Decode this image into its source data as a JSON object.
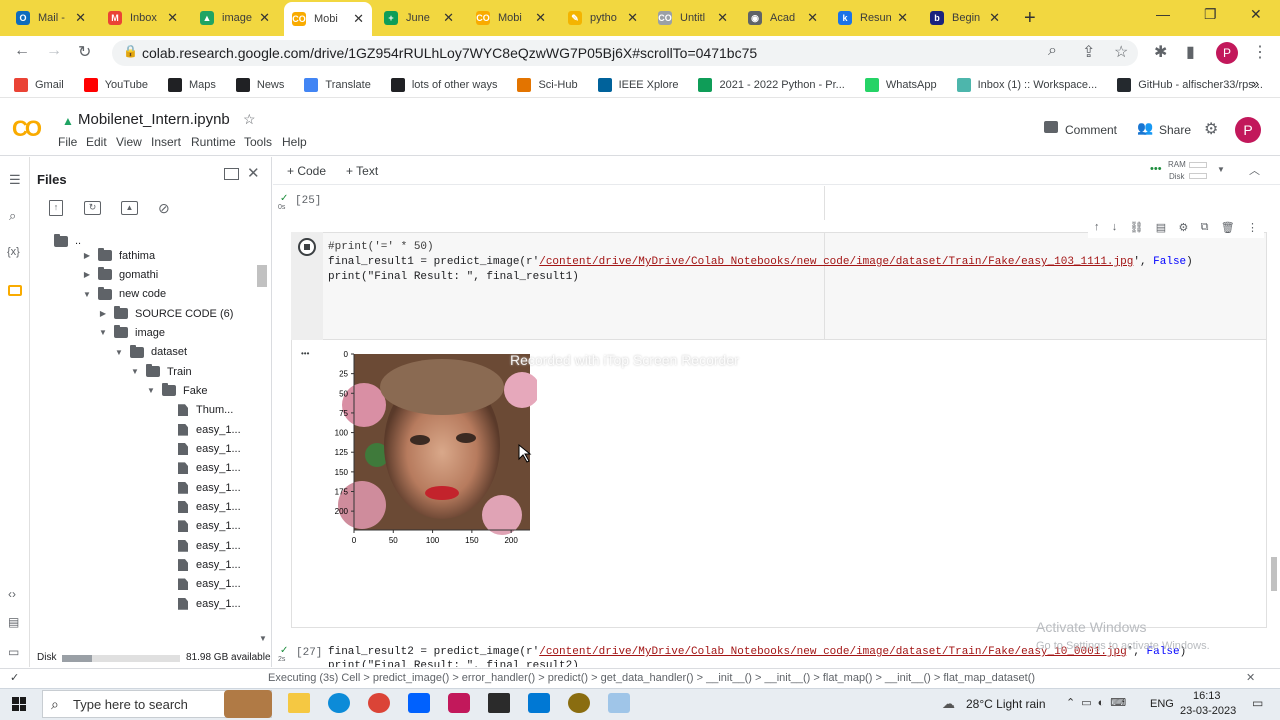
{
  "browser": {
    "tabs": [
      {
        "label": "Mail -",
        "color": "#0f6cbd",
        "glyph": "O"
      },
      {
        "label": "Inbox",
        "color": "#ea4335",
        "glyph": "M"
      },
      {
        "label": "image",
        "color": "#1fa463",
        "glyph": "▲"
      },
      {
        "label": "Mobi",
        "color": "#f9ab00",
        "glyph": "CO"
      },
      {
        "label": "June",
        "color": "#0f9d58",
        "glyph": "+"
      },
      {
        "label": "Mobi",
        "color": "#f9ab00",
        "glyph": "CO"
      },
      {
        "label": "pytho",
        "color": "#f4b400",
        "glyph": "✎"
      },
      {
        "label": "Untitl",
        "color": "#9aa0a6",
        "glyph": "CO"
      },
      {
        "label": "Acad",
        "color": "#5f6368",
        "glyph": "◉"
      },
      {
        "label": "Resun",
        "color": "#1a73e8",
        "glyph": "k"
      },
      {
        "label": "Begin",
        "color": "#1a237e",
        "glyph": "b"
      }
    ],
    "new_tab": "+",
    "url": "colab.research.google.com/drive/1GZ954rRULhLoy7WYC8eQzwWG7P05Bj6X#scrollTo=0471bc75",
    "profile_initial": "P",
    "bookmarks": [
      {
        "label": "Gmail",
        "color": "#ea4335"
      },
      {
        "label": "YouTube",
        "color": "#ff0000"
      },
      {
        "label": "Maps",
        "color": "#202124"
      },
      {
        "label": "News",
        "color": "#202124"
      },
      {
        "label": "Translate",
        "color": "#4285f4"
      },
      {
        "label": "lots of other ways",
        "color": "#202124"
      },
      {
        "label": "Sci-Hub",
        "color": "#e37400"
      },
      {
        "label": "IEEE Xplore",
        "color": "#00629b"
      },
      {
        "label": "2021 - 2022 Python - Pr...",
        "color": "#0f9d58"
      },
      {
        "label": "WhatsApp",
        "color": "#25d366"
      },
      {
        "label": "Inbox (1) :: Workspace...",
        "color": "#4db6ac"
      },
      {
        "label": "GitHub - alfischer33/rps...",
        "color": "#24292e"
      }
    ],
    "more": "»"
  },
  "colab": {
    "logo": "CO",
    "notebook_title": "Mobilenet_Intern.ipynb",
    "menu": [
      "File",
      "Edit",
      "View",
      "Insert",
      "Runtime",
      "Tools",
      "Help"
    ],
    "comment_label": "Comment",
    "share_label": "Share",
    "avatar_initial": "P",
    "add_code": "+ Code",
    "add_text": "+ Text",
    "ram_label": "RAM",
    "disk_label": "Disk"
  },
  "files_panel": {
    "title": "Files",
    "parent": "..",
    "tree": [
      {
        "label": "fathima",
        "type": "folder",
        "level": 1,
        "caret": "▶"
      },
      {
        "label": "gomathi",
        "type": "folder",
        "level": 1,
        "caret": "▶"
      },
      {
        "label": "new code",
        "type": "folder",
        "level": 1,
        "caret": "▼"
      },
      {
        "label": "SOURCE CODE (6)",
        "type": "folder",
        "level": 2,
        "caret": "▶"
      },
      {
        "label": "image",
        "type": "folder",
        "level": 2,
        "caret": "▼"
      },
      {
        "label": "dataset",
        "type": "folder",
        "level": 3,
        "caret": "▼"
      },
      {
        "label": "Train",
        "type": "folder",
        "level": 4,
        "caret": "▼"
      },
      {
        "label": "Fake",
        "type": "folder",
        "level": 5,
        "caret": "▼"
      },
      {
        "label": "Thum...",
        "type": "file",
        "level": 6,
        "caret": ""
      },
      {
        "label": "easy_1...",
        "type": "file",
        "level": 6,
        "caret": ""
      },
      {
        "label": "easy_1...",
        "type": "file",
        "level": 6,
        "caret": ""
      },
      {
        "label": "easy_1...",
        "type": "file",
        "level": 6,
        "caret": ""
      },
      {
        "label": "easy_1...",
        "type": "file",
        "level": 6,
        "caret": ""
      },
      {
        "label": "easy_1...",
        "type": "file",
        "level": 6,
        "caret": ""
      },
      {
        "label": "easy_1...",
        "type": "file",
        "level": 6,
        "caret": ""
      },
      {
        "label": "easy_1...",
        "type": "file",
        "level": 6,
        "caret": ""
      },
      {
        "label": "easy_1...",
        "type": "file",
        "level": 6,
        "caret": ""
      },
      {
        "label": "easy_1...",
        "type": "file",
        "level": 6,
        "caret": ""
      },
      {
        "label": "easy_1...",
        "type": "file",
        "level": 6,
        "caret": ""
      }
    ],
    "disk_label": "Disk",
    "disk_available": "81.98 GB available",
    "disk_used_fraction": 0.25
  },
  "notebook": {
    "cell25": {
      "check": "✓",
      "time": "0s",
      "prompt": "[25]"
    },
    "cell_running": {
      "line1": "#print('=' * 50)",
      "line2_pre": "final_result1 = predict_image(r'",
      "line2_str": "/content/drive/MyDrive/Colab Notebooks/new code/image/dataset/Train/Fake/easy_103_1111.jpg",
      "line2_mid": "', ",
      "line2_kw": "False",
      "line2_post": ")",
      "line3": "print(\"Final Result: \", final_result1)"
    },
    "output_dots": "•••",
    "watermark": "Recorded with iTop Screen Recorder",
    "cell27": {
      "check": "✓",
      "time": "2s",
      "prompt": "[27]",
      "line1_pre": "final_result2 = predict_image(r'",
      "line1_str": "/content/drive/MyDrive/Colab Notebooks/new code/image/dataset/Train/Fake/easy_10_0001.jpg",
      "line1_mid": "', ",
      "line1_kw": "False",
      "line1_post": ")",
      "line2": "print(\"Final Result: \", final_result2)"
    },
    "activate_windows": "Activate Windows",
    "activate_sub": "Go to Settings to activate Windows."
  },
  "chart_data": {
    "type": "image",
    "x_ticks": [
      "0",
      "50",
      "100",
      "150",
      "200"
    ],
    "y_ticks": [
      "0",
      "25",
      "50",
      "75",
      "100",
      "125",
      "150",
      "175",
      "200"
    ],
    "xlim": [
      0,
      224
    ],
    "ylim": [
      224,
      0
    ]
  },
  "status_bar": {
    "text": "Executing (3s)  Cell > predict_image() > error_handler() > predict() > get_data_handler() > __init__() > __init__() > flat_map() > __init__() > flat_map_dataset()"
  },
  "taskbar": {
    "search_placeholder": "Type here to search",
    "weather": "28°C  Light rain",
    "lang": "ENG",
    "time": "16:13",
    "date": "23-03-2023"
  }
}
